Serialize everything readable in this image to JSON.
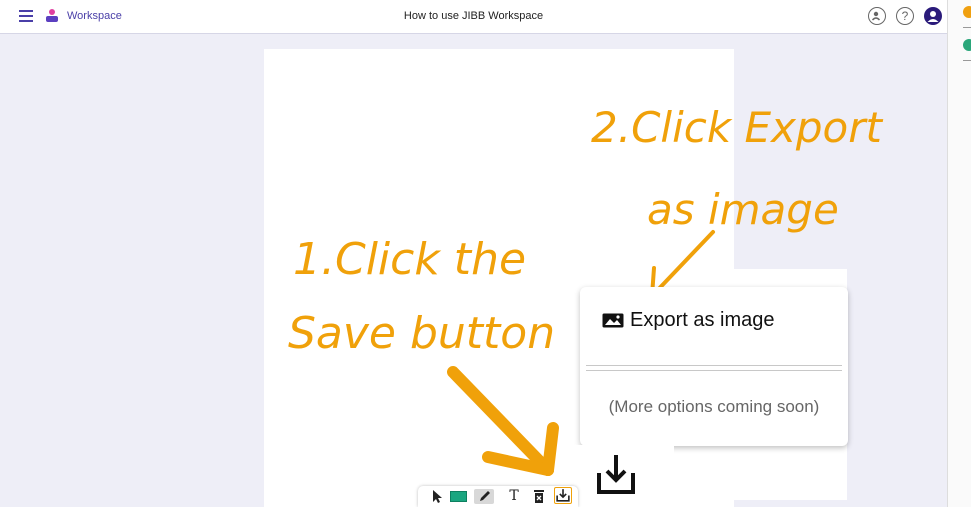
{
  "header": {
    "brand_label": "Workspace",
    "doc_title": "How to use JIBB Workspace",
    "icons": [
      "menu-icon",
      "workspace-logo-icon",
      "collaborators-icon",
      "help-icon",
      "profile-icon"
    ]
  },
  "annotations": {
    "step2_line1": "2.Click Export",
    "step2_line2": "as image",
    "step1_line1": "1.Click the",
    "step1_line2": "Save button",
    "color": "#f0a10a"
  },
  "export_menu": {
    "export_label": "Export as image",
    "more_options": "(More options coming soon)"
  },
  "toolbar": {
    "text_tool_glyph": "T",
    "pen_color": "#1aa680",
    "tools": [
      "pointer-icon",
      "color-swatch",
      "pen-icon",
      "text-icon",
      "clear-icon",
      "save-icon"
    ]
  },
  "colors": {
    "accent": "#4a3fa8",
    "annotation": "#f0a10a",
    "background": "#eeeef7"
  }
}
